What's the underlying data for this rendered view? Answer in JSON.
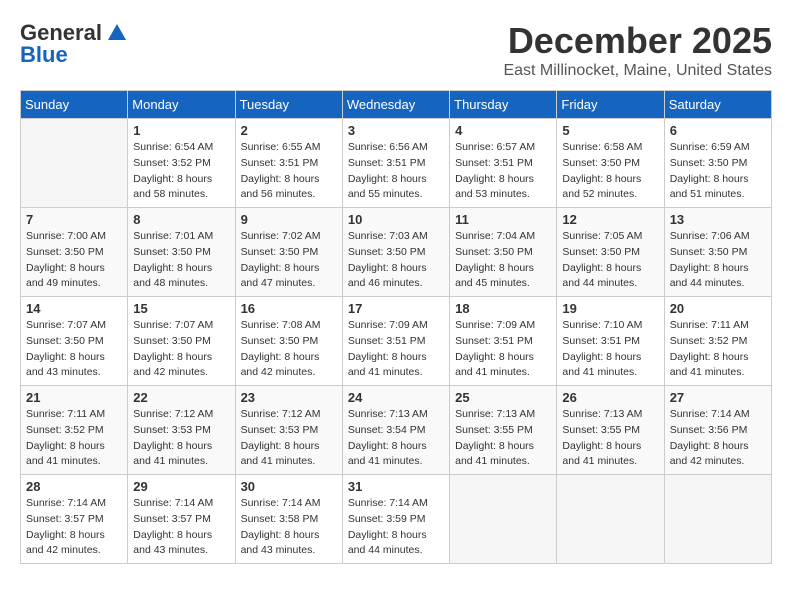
{
  "header": {
    "logo_general": "General",
    "logo_blue": "Blue",
    "month_title": "December 2025",
    "location": "East Millinocket, Maine, United States"
  },
  "weekdays": [
    "Sunday",
    "Monday",
    "Tuesday",
    "Wednesday",
    "Thursday",
    "Friday",
    "Saturday"
  ],
  "weeks": [
    [
      {
        "day": "",
        "sunrise": "",
        "sunset": "",
        "daylight": ""
      },
      {
        "day": "1",
        "sunrise": "Sunrise: 6:54 AM",
        "sunset": "Sunset: 3:52 PM",
        "daylight": "Daylight: 8 hours and 58 minutes."
      },
      {
        "day": "2",
        "sunrise": "Sunrise: 6:55 AM",
        "sunset": "Sunset: 3:51 PM",
        "daylight": "Daylight: 8 hours and 56 minutes."
      },
      {
        "day": "3",
        "sunrise": "Sunrise: 6:56 AM",
        "sunset": "Sunset: 3:51 PM",
        "daylight": "Daylight: 8 hours and 55 minutes."
      },
      {
        "day": "4",
        "sunrise": "Sunrise: 6:57 AM",
        "sunset": "Sunset: 3:51 PM",
        "daylight": "Daylight: 8 hours and 53 minutes."
      },
      {
        "day": "5",
        "sunrise": "Sunrise: 6:58 AM",
        "sunset": "Sunset: 3:50 PM",
        "daylight": "Daylight: 8 hours and 52 minutes."
      },
      {
        "day": "6",
        "sunrise": "Sunrise: 6:59 AM",
        "sunset": "Sunset: 3:50 PM",
        "daylight": "Daylight: 8 hours and 51 minutes."
      }
    ],
    [
      {
        "day": "7",
        "sunrise": "Sunrise: 7:00 AM",
        "sunset": "Sunset: 3:50 PM",
        "daylight": "Daylight: 8 hours and 49 minutes."
      },
      {
        "day": "8",
        "sunrise": "Sunrise: 7:01 AM",
        "sunset": "Sunset: 3:50 PM",
        "daylight": "Daylight: 8 hours and 48 minutes."
      },
      {
        "day": "9",
        "sunrise": "Sunrise: 7:02 AM",
        "sunset": "Sunset: 3:50 PM",
        "daylight": "Daylight: 8 hours and 47 minutes."
      },
      {
        "day": "10",
        "sunrise": "Sunrise: 7:03 AM",
        "sunset": "Sunset: 3:50 PM",
        "daylight": "Daylight: 8 hours and 46 minutes."
      },
      {
        "day": "11",
        "sunrise": "Sunrise: 7:04 AM",
        "sunset": "Sunset: 3:50 PM",
        "daylight": "Daylight: 8 hours and 45 minutes."
      },
      {
        "day": "12",
        "sunrise": "Sunrise: 7:05 AM",
        "sunset": "Sunset: 3:50 PM",
        "daylight": "Daylight: 8 hours and 44 minutes."
      },
      {
        "day": "13",
        "sunrise": "Sunrise: 7:06 AM",
        "sunset": "Sunset: 3:50 PM",
        "daylight": "Daylight: 8 hours and 44 minutes."
      }
    ],
    [
      {
        "day": "14",
        "sunrise": "Sunrise: 7:07 AM",
        "sunset": "Sunset: 3:50 PM",
        "daylight": "Daylight: 8 hours and 43 minutes."
      },
      {
        "day": "15",
        "sunrise": "Sunrise: 7:07 AM",
        "sunset": "Sunset: 3:50 PM",
        "daylight": "Daylight: 8 hours and 42 minutes."
      },
      {
        "day": "16",
        "sunrise": "Sunrise: 7:08 AM",
        "sunset": "Sunset: 3:50 PM",
        "daylight": "Daylight: 8 hours and 42 minutes."
      },
      {
        "day": "17",
        "sunrise": "Sunrise: 7:09 AM",
        "sunset": "Sunset: 3:51 PM",
        "daylight": "Daylight: 8 hours and 41 minutes."
      },
      {
        "day": "18",
        "sunrise": "Sunrise: 7:09 AM",
        "sunset": "Sunset: 3:51 PM",
        "daylight": "Daylight: 8 hours and 41 minutes."
      },
      {
        "day": "19",
        "sunrise": "Sunrise: 7:10 AM",
        "sunset": "Sunset: 3:51 PM",
        "daylight": "Daylight: 8 hours and 41 minutes."
      },
      {
        "day": "20",
        "sunrise": "Sunrise: 7:11 AM",
        "sunset": "Sunset: 3:52 PM",
        "daylight": "Daylight: 8 hours and 41 minutes."
      }
    ],
    [
      {
        "day": "21",
        "sunrise": "Sunrise: 7:11 AM",
        "sunset": "Sunset: 3:52 PM",
        "daylight": "Daylight: 8 hours and 41 minutes."
      },
      {
        "day": "22",
        "sunrise": "Sunrise: 7:12 AM",
        "sunset": "Sunset: 3:53 PM",
        "daylight": "Daylight: 8 hours and 41 minutes."
      },
      {
        "day": "23",
        "sunrise": "Sunrise: 7:12 AM",
        "sunset": "Sunset: 3:53 PM",
        "daylight": "Daylight: 8 hours and 41 minutes."
      },
      {
        "day": "24",
        "sunrise": "Sunrise: 7:13 AM",
        "sunset": "Sunset: 3:54 PM",
        "daylight": "Daylight: 8 hours and 41 minutes."
      },
      {
        "day": "25",
        "sunrise": "Sunrise: 7:13 AM",
        "sunset": "Sunset: 3:55 PM",
        "daylight": "Daylight: 8 hours and 41 minutes."
      },
      {
        "day": "26",
        "sunrise": "Sunrise: 7:13 AM",
        "sunset": "Sunset: 3:55 PM",
        "daylight": "Daylight: 8 hours and 41 minutes."
      },
      {
        "day": "27",
        "sunrise": "Sunrise: 7:14 AM",
        "sunset": "Sunset: 3:56 PM",
        "daylight": "Daylight: 8 hours and 42 minutes."
      }
    ],
    [
      {
        "day": "28",
        "sunrise": "Sunrise: 7:14 AM",
        "sunset": "Sunset: 3:57 PM",
        "daylight": "Daylight: 8 hours and 42 minutes."
      },
      {
        "day": "29",
        "sunrise": "Sunrise: 7:14 AM",
        "sunset": "Sunset: 3:57 PM",
        "daylight": "Daylight: 8 hours and 43 minutes."
      },
      {
        "day": "30",
        "sunrise": "Sunrise: 7:14 AM",
        "sunset": "Sunset: 3:58 PM",
        "daylight": "Daylight: 8 hours and 43 minutes."
      },
      {
        "day": "31",
        "sunrise": "Sunrise: 7:14 AM",
        "sunset": "Sunset: 3:59 PM",
        "daylight": "Daylight: 8 hours and 44 minutes."
      },
      {
        "day": "",
        "sunrise": "",
        "sunset": "",
        "daylight": ""
      },
      {
        "day": "",
        "sunrise": "",
        "sunset": "",
        "daylight": ""
      },
      {
        "day": "",
        "sunrise": "",
        "sunset": "",
        "daylight": ""
      }
    ]
  ]
}
